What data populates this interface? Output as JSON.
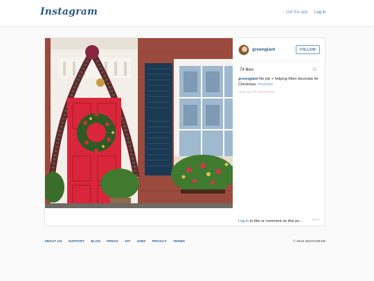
{
  "header": {
    "logo": "Instagram",
    "get_app": "Get the app",
    "login": "Log in"
  },
  "post": {
    "username": "greengiant",
    "follow_label": "FOLLOW",
    "likes": "74 likes",
    "time": "2h",
    "caption_user": "greengiant",
    "caption_text": " No job + helping Mom decorate for Christmas. ",
    "caption_tag": "#hohoho",
    "view_comments": "view all 18 comments",
    "login_link": "Log in",
    "login_rest": " to like or comment on this po...",
    "more": "•••"
  },
  "footer": {
    "links": [
      "ABOUT US",
      "SUPPORT",
      "BLOG",
      "PRESS",
      "API",
      "JOBS",
      "PRIVACY",
      "TERMS"
    ],
    "copyright": "© 2015 INSTAGRAM"
  },
  "colors": {
    "accent": "#3f729b",
    "door": "#d9263b",
    "brick": "#9b4a3e"
  }
}
